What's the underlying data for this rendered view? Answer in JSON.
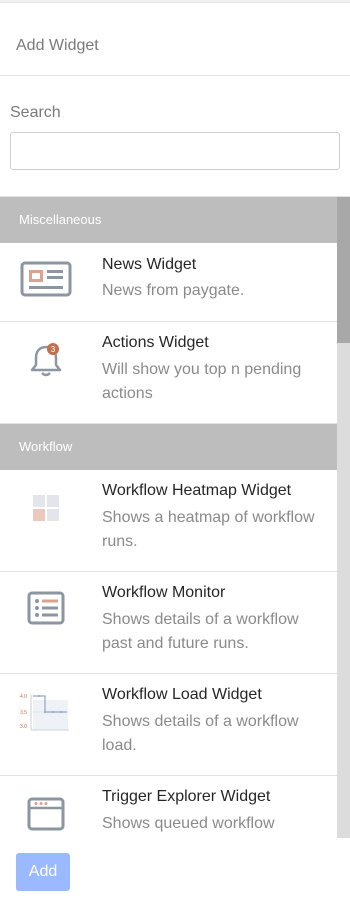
{
  "dialog": {
    "title": "Add Widget"
  },
  "search": {
    "label": "Search",
    "value": "",
    "placeholder": ""
  },
  "categories": [
    {
      "label": "Miscellaneous",
      "widgets": [
        {
          "name": "News Widget",
          "description": "News from paygate.",
          "icon": "newspaper-icon"
        },
        {
          "name": "Actions Widget",
          "description": "Will show you top n pending actions",
          "icon": "bell-icon",
          "badge": "3"
        }
      ]
    },
    {
      "label": "Workflow",
      "widgets": [
        {
          "name": "Workflow Heatmap Widget",
          "description": "Shows a heatmap of workflow runs.",
          "icon": "heatmap-icon"
        },
        {
          "name": "Workflow Monitor",
          "description": "Shows details of a workflow past and future runs.",
          "icon": "list-icon"
        },
        {
          "name": "Workflow Load Widget",
          "description": "Shows details of a workflow load.",
          "icon": "load-chart-icon",
          "icon_ticks": [
            "4.0",
            "3.5",
            "3.0"
          ]
        },
        {
          "name": "Trigger Explorer Widget",
          "description": "Shows queued workflow",
          "icon": "browser-window-icon"
        }
      ]
    }
  ],
  "footer": {
    "add_label": "Add"
  },
  "colors": {
    "category_bg": "#bdbdbd",
    "icon_gray": "#8c96a0",
    "icon_accent": "#d9a38f",
    "badge": "#c0704f",
    "add_button": "#9bb9ff"
  }
}
